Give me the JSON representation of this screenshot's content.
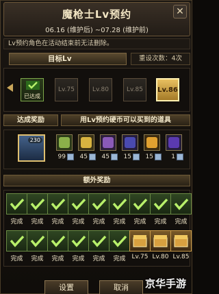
{
  "window": {
    "title": "魔枪士Lv预约",
    "date_range": "06.16 (维护后) ~07.28 (维护前)",
    "close_label": "✕"
  },
  "notice": "Lv预约角色在活动结束前无法删除。",
  "target": {
    "label": "目标Lv",
    "reset_text": "重设次数：4次"
  },
  "levels": [
    {
      "label": "已达成",
      "state": "done"
    },
    {
      "label": "Lv.75",
      "state": "locked"
    },
    {
      "label": "Lv.80",
      "state": "locked"
    },
    {
      "label": "Lv.85",
      "state": "locked"
    },
    {
      "label": "Lv.86",
      "state": "current"
    }
  ],
  "reward": {
    "achieve_label": "达成奖励",
    "shop_label": "用Lv预约硬币可以买到的道具",
    "main_item_badge": "230",
    "items": [
      {
        "qty": "99"
      },
      {
        "qty": "45"
      },
      {
        "qty": "45"
      },
      {
        "qty": "15"
      },
      {
        "qty": "15"
      },
      {
        "qty": "1"
      }
    ]
  },
  "extra": {
    "label": "额外奖励",
    "row1": [
      "完成",
      "完成",
      "完成",
      "完成",
      "完成",
      "完成",
      "完成",
      "完成",
      "完成"
    ],
    "row2": [
      "完成",
      "完成",
      "完成",
      "完成",
      "完成",
      "完成",
      "Lv.75",
      "Lv.80",
      "Lv.85"
    ]
  },
  "buttons": {
    "settings": "设置",
    "cancel": "取消"
  },
  "watermark": "京华手游",
  "colors": {
    "accent": "#c9a65a",
    "complete_green": "#7ea84a",
    "current_gold": "#e8c060"
  }
}
